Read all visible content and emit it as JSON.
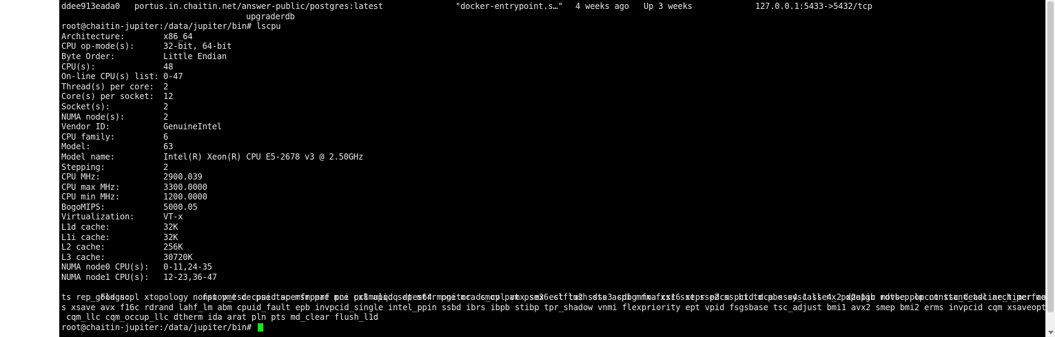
{
  "terminal": {
    "docker_row": {
      "container_id": "ddee913eada0",
      "image": "portus.in.chaitin.net/answer-public/postgres:latest",
      "command": "\"docker-entrypoint.s…\"",
      "created": "4 weeks ago",
      "status": "Up 3 weeks",
      "ports": "127.0.0.1:5433->5432/tcp",
      "name": "upgraderdb"
    },
    "prompt_cmd": "root@chaitin-jupiter:/data/jupiter/bin# lscpu",
    "lscpu": [
      {
        "key": "Architecture:",
        "value": "x86_64"
      },
      {
        "key": "CPU op-mode(s):",
        "value": "32-bit, 64-bit"
      },
      {
        "key": "Byte Order:",
        "value": "Little Endian"
      },
      {
        "key": "CPU(s):",
        "value": "48"
      },
      {
        "key": "On-line CPU(s) list:",
        "value": "0-47"
      },
      {
        "key": "Thread(s) per core:",
        "value": "2"
      },
      {
        "key": "Core(s) per socket:",
        "value": "12"
      },
      {
        "key": "Socket(s):",
        "value": "2"
      },
      {
        "key": "NUMA node(s):",
        "value": "2"
      },
      {
        "key": "Vendor ID:",
        "value": "GenuineIntel"
      },
      {
        "key": "CPU family:",
        "value": "6"
      },
      {
        "key": "Model:",
        "value": "63"
      },
      {
        "key": "Model name:",
        "value": "Intel(R) Xeon(R) CPU E5-2678 v3 @ 2.50GHz"
      },
      {
        "key": "Stepping:",
        "value": "2"
      },
      {
        "key": "CPU MHz:",
        "value": "2900.039"
      },
      {
        "key": "CPU max MHz:",
        "value": "3300.0000"
      },
      {
        "key": "CPU min MHz:",
        "value": "1200.0000"
      },
      {
        "key": "BogoMIPS:",
        "value": "5000.05"
      },
      {
        "key": "Virtualization:",
        "value": "VT-x"
      },
      {
        "key": "L1d cache:",
        "value": "32K"
      },
      {
        "key": "L1i cache:",
        "value": "32K"
      },
      {
        "key": "L2 cache:",
        "value": "256K"
      },
      {
        "key": "L3 cache:",
        "value": "30720K"
      },
      {
        "key": "NUMA node0 CPU(s):",
        "value": "0-11,24-35"
      },
      {
        "key": "NUMA node1 CPU(s):",
        "value": "12-23,36-47"
      }
    ],
    "flags_label": "Flags:",
    "flags_lines": [
      "fpu vme de pse tsc msr pae mce cx8 apic sep mtrr pge mca cmov pat pse36 clflush dts acpi mmx fxsr sse sse2 ss ht tm pbe syscall nx pdpe1gb rdtscp lm constant_tsc arch_perfmon pebs b",
      "ts rep_good nopl xtopology nonstop_tsc cpuid aperfmperf pni pclmulqdq dtes64 monitor ds_cpl vmx smx est tm2 ssse3 sdbg fma cx16 xtpr pdcm pcid dca sse4_1 sse4_2 x2apic movbe popcnt tsc_deadline_timer ae",
      "s xsave avx f16c rdrand lahf_lm abm cpuid_fault epb invpcid_single intel_ppin ssbd ibrs ibpb stibp tpr_shadow vnmi flexpriority ept vpid fsgsbase tsc_adjust bmi1 avx2 smep bmi2 erms invpcid cqm xsaveopt",
      " cqm_llc cqm_occup_llc dtherm ida arat pln pts md_clear flush_l1d"
    ],
    "final_prompt": "root@chaitin-jupiter:/data/jupiter/bin# "
  },
  "colors": {
    "background": "#000000",
    "text": "#e6e6e6",
    "cursor": "#22e022"
  }
}
